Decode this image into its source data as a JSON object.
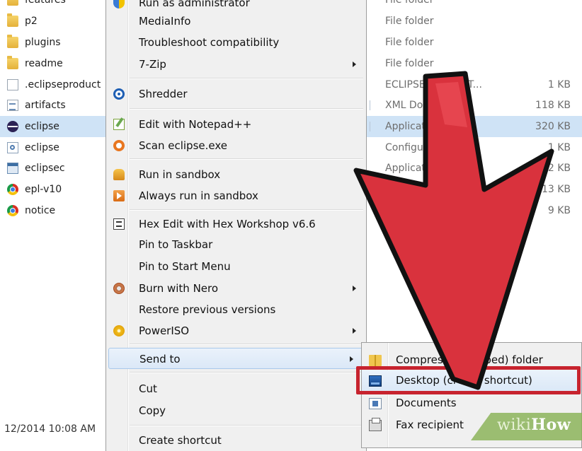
{
  "file_list": [
    {
      "name": "features",
      "icon": "folder-icon"
    },
    {
      "name": "p2",
      "icon": "folder-icon"
    },
    {
      "name": "plugins",
      "icon": "folder-icon"
    },
    {
      "name": "readme",
      "icon": "folder-icon"
    },
    {
      "name": ".eclipseproduct",
      "icon": "document-icon"
    },
    {
      "name": "artifacts",
      "icon": "xml-icon"
    },
    {
      "name": "eclipse",
      "icon": "eclipse-icon",
      "selected": true
    },
    {
      "name": "eclipse",
      "icon": "config-icon"
    },
    {
      "name": "eclipsec",
      "icon": "application-icon"
    },
    {
      "name": "epl-v10",
      "icon": "chrome-icon"
    },
    {
      "name": "notice",
      "icon": "chrome-icon"
    }
  ],
  "bottom_date": "12/2014 10:08 AM",
  "details": [
    {
      "type": "File folder",
      "size": ""
    },
    {
      "type": "File folder",
      "size": ""
    },
    {
      "type": "File folder",
      "size": ""
    },
    {
      "type": "File folder",
      "size": ""
    },
    {
      "type": "ECLIPSEPRODUCT...",
      "size": "1 KB"
    },
    {
      "type": "XML Document",
      "size": "118 KB"
    },
    {
      "type": "Application",
      "size": "320 KB",
      "selected": true
    },
    {
      "type": "Configuration s...",
      "size": "1 KB"
    },
    {
      "type": "Application",
      "size": "22 KB"
    },
    {
      "type": "",
      "size": "13 KB"
    },
    {
      "type": "",
      "size": "9 KB"
    }
  ],
  "context_menu": {
    "run_as_admin": "Run as administrator",
    "mediainfo": "MediaInfo",
    "troubleshoot": "Troubleshoot compatibility",
    "seven_zip": "7-Zip",
    "shredder": "Shredder",
    "notepadpp": "Edit with Notepad++",
    "scan": "Scan eclipse.exe",
    "sandbox": "Run in sandbox",
    "always_sandbox": "Always run in sandbox",
    "hex_edit": "Hex Edit with Hex Workshop v6.6",
    "pin_taskbar": "Pin to Taskbar",
    "pin_start": "Pin to Start Menu",
    "burn_nero": "Burn with Nero",
    "restore": "Restore previous versions",
    "poweriso": "PowerISO",
    "send_to": "Send to",
    "cut": "Cut",
    "copy": "Copy",
    "create_shortcut": "Create shortcut"
  },
  "send_to_menu": {
    "compressed": "Compressed (zipped) folder",
    "desktop": "Desktop (create shortcut)",
    "documents": "Documents",
    "fax": "Fax recipient"
  },
  "watermark": {
    "wiki": "wiki",
    "how": "How"
  },
  "colors": {
    "arrow": "#d9323d",
    "highlight_box": "#c7232e",
    "selection": "#cfe3f6"
  }
}
